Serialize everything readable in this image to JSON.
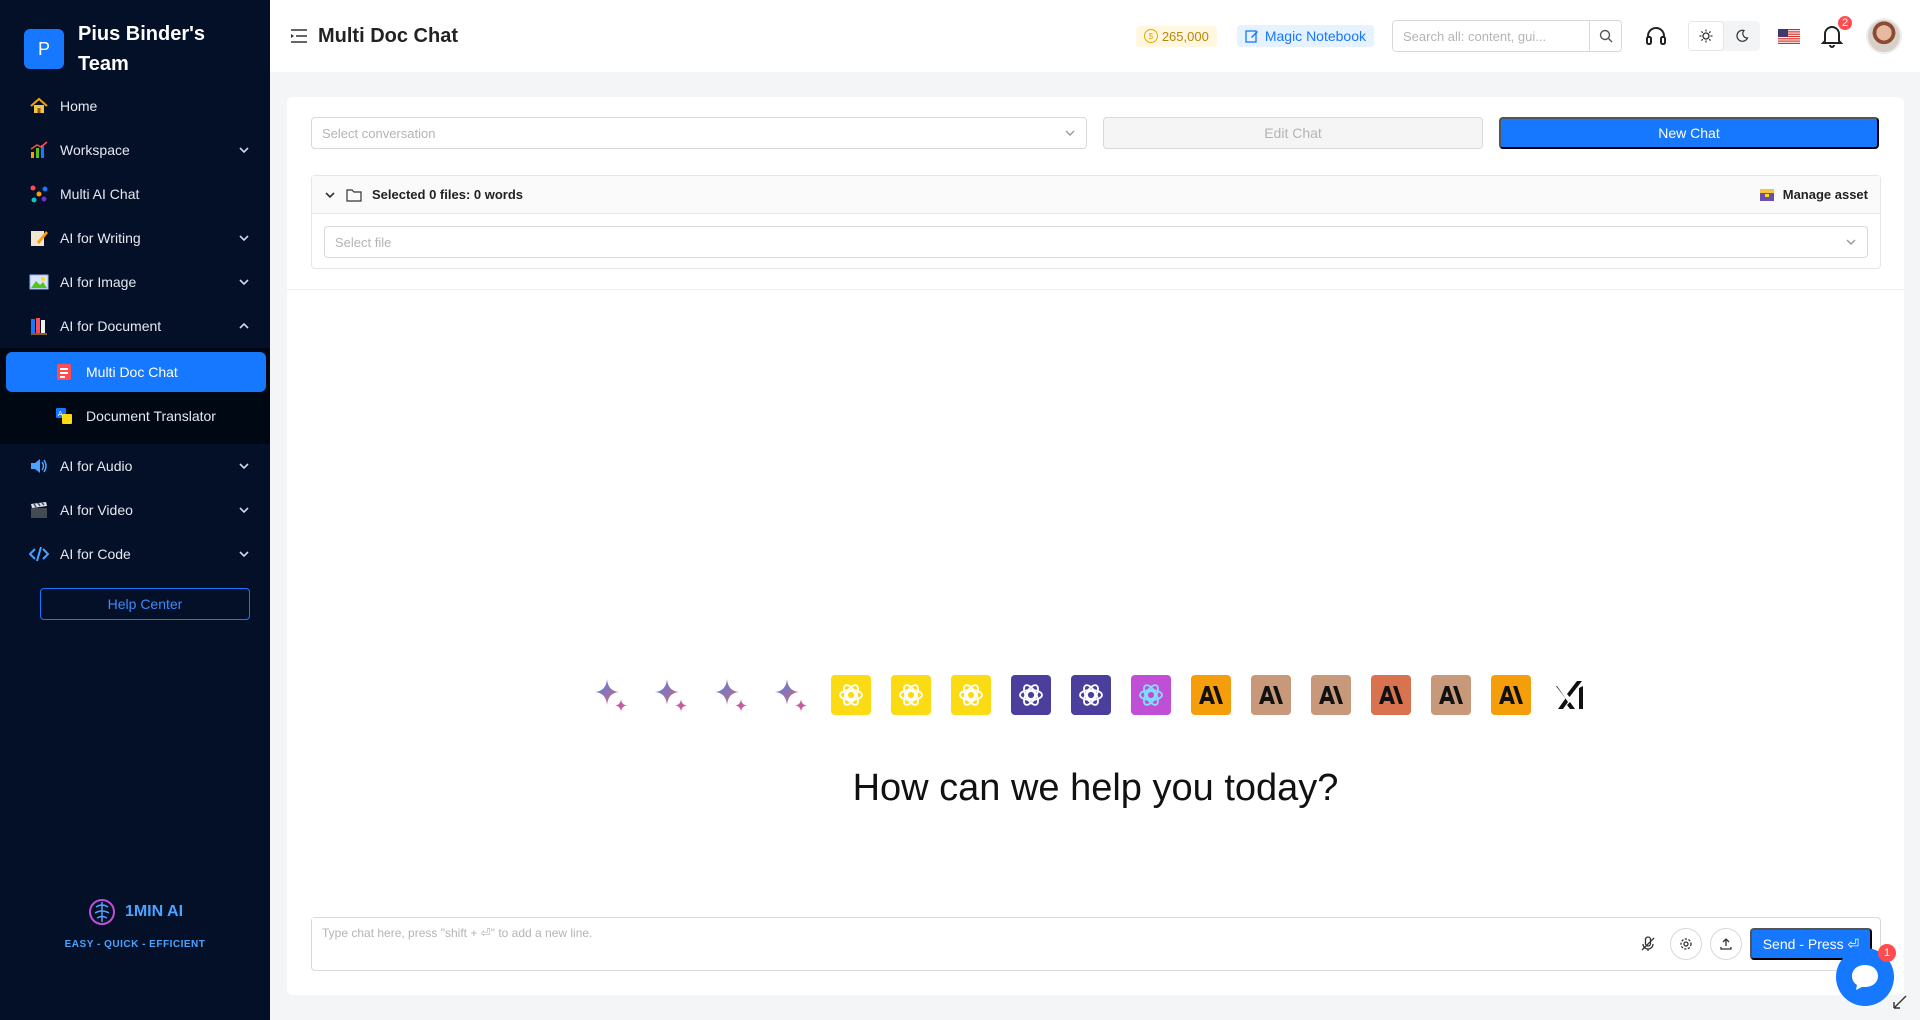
{
  "sidebar": {
    "team_initial": "P",
    "team_name": "Pius Binder's Team",
    "items": [
      {
        "label": "Home",
        "icon": "home-icon",
        "expandable": false
      },
      {
        "label": "Workspace",
        "icon": "chart-icon",
        "expandable": true
      },
      {
        "label": "Multi AI Chat",
        "icon": "network-icon",
        "expandable": false
      },
      {
        "label": "AI for Writing",
        "icon": "writing-icon",
        "expandable": true
      },
      {
        "label": "AI for Image",
        "icon": "image-icon",
        "expandable": true
      },
      {
        "label": "AI for Document",
        "icon": "books-icon",
        "expandable": true,
        "expanded": true
      },
      {
        "label": "AI for Audio",
        "icon": "speaker-icon",
        "expandable": true
      },
      {
        "label": "AI for Video",
        "icon": "clapper-icon",
        "expandable": true
      },
      {
        "label": "AI for Code",
        "icon": "code-icon",
        "expandable": true
      }
    ],
    "subitems": [
      {
        "label": "Multi Doc Chat",
        "icon": "doc-chat-icon",
        "active": true
      },
      {
        "label": "Document Translator",
        "icon": "translate-icon",
        "active": false
      }
    ],
    "help_label": "Help Center",
    "logo_text": "1MIN AI",
    "logo_sub": "EASY - QUICK - EFFICIENT"
  },
  "header": {
    "title": "Multi Doc Chat",
    "credits": "265,000",
    "magic_label": "Magic Notebook",
    "search_placeholder": "Search all: content, gui...",
    "notifications": "2"
  },
  "main": {
    "conversation_placeholder": "Select conversation",
    "edit_label": "Edit Chat",
    "new_label": "New Chat",
    "files_summary": "Selected 0 files: 0 words",
    "manage_label": "Manage asset",
    "file_placeholder": "Select file",
    "greeting": "How can we help you today?",
    "chat_placeholder": "Type chat here, press \"shift + ⏎\" to add a new line.",
    "send_label": "Send - Press ⏎",
    "chat_badge": "1"
  },
  "models": [
    {
      "icon": "gemini-icon",
      "bg": "none"
    },
    {
      "icon": "gemini-icon",
      "bg": "none"
    },
    {
      "icon": "gemini-icon",
      "bg": "none"
    },
    {
      "icon": "gemini-icon",
      "bg": "none"
    },
    {
      "icon": "openai-icon",
      "bg": "#fadb14"
    },
    {
      "icon": "openai-icon",
      "bg": "#fadb14"
    },
    {
      "icon": "openai-icon",
      "bg": "#fadb14"
    },
    {
      "icon": "openai-icon",
      "bg": "#4b3f9e"
    },
    {
      "icon": "openai-icon",
      "bg": "#4b3f9e"
    },
    {
      "icon": "openai-gradient-icon",
      "bg": "#c14fd6"
    },
    {
      "icon": "anthropic-icon",
      "bg": "#f59e0b"
    },
    {
      "icon": "anthropic-icon",
      "bg": "#c8987a"
    },
    {
      "icon": "anthropic-icon",
      "bg": "#c8987a"
    },
    {
      "icon": "anthropic-icon",
      "bg": "#d9734f"
    },
    {
      "icon": "anthropic-icon",
      "bg": "#c8987a"
    },
    {
      "icon": "anthropic-icon",
      "bg": "#f59e0b"
    },
    {
      "icon": "xai-icon",
      "bg": "none"
    }
  ],
  "colors": {
    "primary": "#1677ff",
    "sidebar": "#041027"
  }
}
